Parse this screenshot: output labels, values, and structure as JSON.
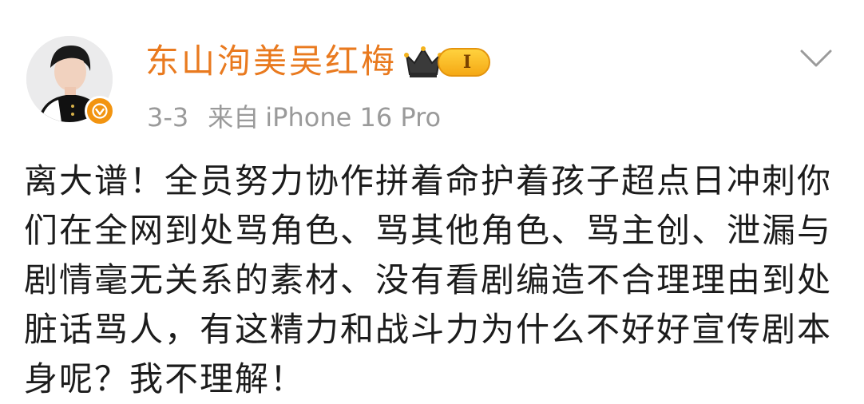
{
  "post": {
    "author": {
      "name": "东山洵美吴红梅",
      "level": "I",
      "avatar_icon": "avatar-portrait",
      "verified_icon": "verified-check-icon",
      "crown_icon": "crown-icon"
    },
    "meta": {
      "date": "3-3",
      "source_prefix": "来自",
      "device": "iPhone 16 Pro"
    },
    "body_lines": [
      "离大谱！全员努力协作拼着命护着孩子超点日冲刺你",
      "们在全网到处骂角色、骂其他角色、骂主创、泄漏与",
      "剧情毫无关系的素材、没有看剧编造不合理理由到处",
      "脏话骂人，有这精力和战斗力为什么不好好宣传剧本",
      "身呢？我不理解！"
    ],
    "colors": {
      "username": "#e97a1f",
      "meta": "#9a9a9a",
      "text": "#1c1c1c",
      "badge_orange": "#f29410",
      "level_gold": "#ffd23e"
    }
  }
}
